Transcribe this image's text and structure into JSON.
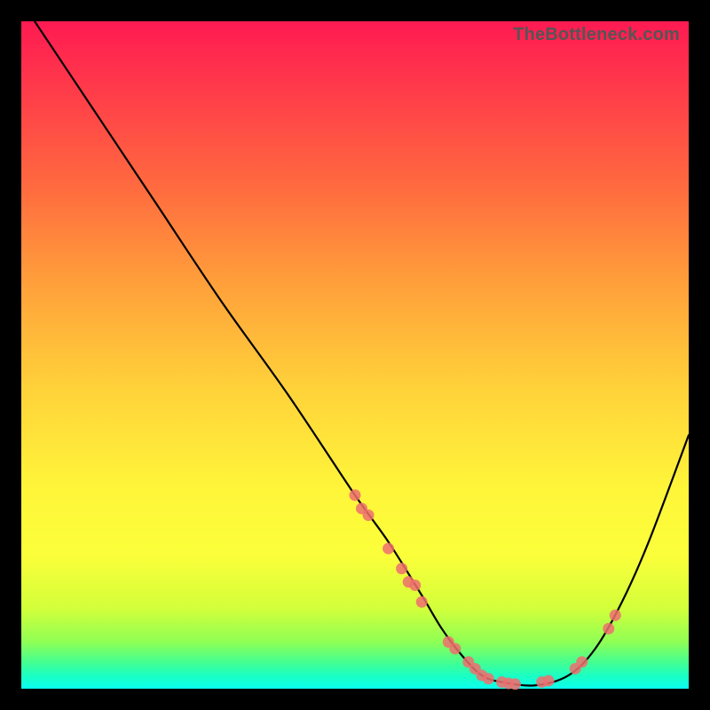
{
  "watermark": "TheBottleneck.com",
  "colors": {
    "page_bg": "#000000",
    "curve": "#000000",
    "point_fill": "#ef6f6f",
    "point_stroke": "#ef6f6f",
    "gradient_top": "#ff1a52",
    "gradient_bottom": "#0affef"
  },
  "chart_data": {
    "type": "line",
    "title": "",
    "xlabel": "",
    "ylabel": "",
    "xlim": [
      0,
      100
    ],
    "ylim": [
      0,
      100
    ],
    "x": [
      2,
      10,
      20,
      30,
      40,
      50,
      55,
      60,
      63,
      66,
      69,
      72,
      77,
      82,
      86,
      90,
      94,
      100
    ],
    "values": [
      100,
      88,
      73,
      58,
      44,
      29,
      22,
      14,
      9,
      5,
      2,
      1,
      0.5,
      2,
      6,
      13,
      22,
      38
    ],
    "series": [
      {
        "name": "markers",
        "points": [
          {
            "x": 50,
            "y": 29
          },
          {
            "x": 51,
            "y": 27
          },
          {
            "x": 52,
            "y": 26
          },
          {
            "x": 55,
            "y": 21
          },
          {
            "x": 57,
            "y": 18
          },
          {
            "x": 58,
            "y": 16
          },
          {
            "x": 59,
            "y": 15.5
          },
          {
            "x": 60,
            "y": 13
          },
          {
            "x": 64,
            "y": 7
          },
          {
            "x": 65,
            "y": 6
          },
          {
            "x": 67,
            "y": 4
          },
          {
            "x": 68,
            "y": 3
          },
          {
            "x": 69,
            "y": 2
          },
          {
            "x": 70,
            "y": 1.5
          },
          {
            "x": 72,
            "y": 1
          },
          {
            "x": 73,
            "y": 0.8
          },
          {
            "x": 74,
            "y": 0.7
          },
          {
            "x": 78,
            "y": 1
          },
          {
            "x": 79,
            "y": 1.2
          },
          {
            "x": 83,
            "y": 3
          },
          {
            "x": 84,
            "y": 4
          },
          {
            "x": 88,
            "y": 9
          },
          {
            "x": 89,
            "y": 11
          }
        ]
      }
    ]
  }
}
